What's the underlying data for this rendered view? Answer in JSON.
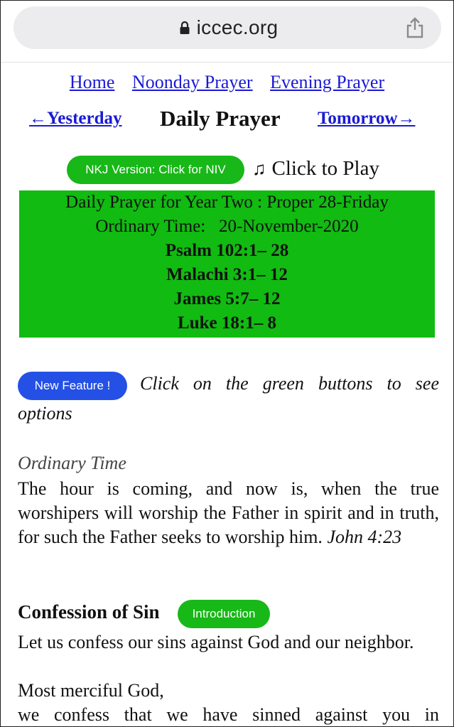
{
  "browser": {
    "url": "iccec.org"
  },
  "nav": {
    "home": "Home",
    "noonday": "Noonday Prayer",
    "evening": "Evening Prayer"
  },
  "day": {
    "yesterday": "←Yesterday",
    "title": "Daily Prayer",
    "tomorrow": "Tomorrow→"
  },
  "version_button": "NKJ Version: Click for NIV",
  "play": {
    "note": "♫",
    "label": "Click to Play"
  },
  "readings": {
    "line1": "Daily Prayer for Year Two : Proper 28-Friday",
    "line2": "Ordinary Time:   20-November-2020",
    "items": [
      "Psalm 102:1– 28",
      "Malachi 3:1– 12",
      "James 5:7– 12",
      "Luke 18:1– 8"
    ]
  },
  "feature": {
    "button": "New Feature !",
    "text_line1": "Click on the green buttons to see",
    "text_line2": "options"
  },
  "season_label": "Ordinary Time",
  "verse": {
    "text": "The hour is coming, and now is, when the true worshipers will worship the Father in spirit and in truth, for such the Father seeks to worship him.",
    "reference": "John 4:23"
  },
  "confession": {
    "title": "Confession of Sin",
    "intro_button": "Introduction",
    "invitation": "Let us confess our sins against God and our neighbor.",
    "line1": "Most merciful God,",
    "line2": "we confess that we have sinned against you in"
  },
  "colors": {
    "green": "#11bb11",
    "link": "#1a1ad6",
    "blue_pill": "#2450e6"
  },
  "icons": [
    "lock-icon",
    "share-icon",
    "music-note-icon"
  ]
}
